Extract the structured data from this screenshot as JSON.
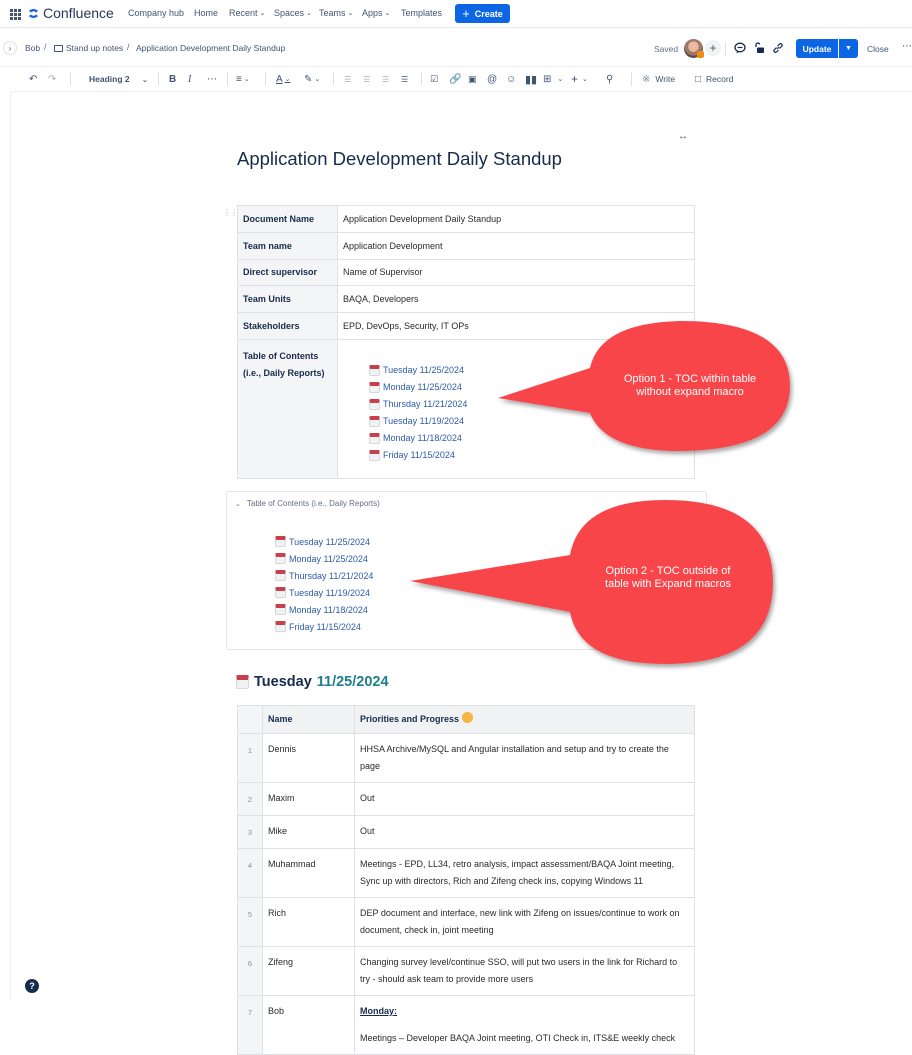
{
  "topnav": {
    "product": "Confluence",
    "items": [
      {
        "label": "Company hub",
        "dropdown": false
      },
      {
        "label": "Home",
        "dropdown": false
      },
      {
        "label": "Recent",
        "dropdown": true
      },
      {
        "label": "Spaces",
        "dropdown": true
      },
      {
        "label": "Teams",
        "dropdown": true
      },
      {
        "label": "Apps",
        "dropdown": true
      },
      {
        "label": "Templates",
        "dropdown": false
      }
    ],
    "create_label": "Create",
    "brand_color": "#0c66e4"
  },
  "subbar": {
    "breadcrumb": [
      "Bob",
      "Stand up notes",
      "Application Development Daily Standup"
    ],
    "saved_label": "Saved",
    "update_label": "Update",
    "close_label": "Close"
  },
  "toolbar": {
    "text_style": "Heading 2",
    "write_label": "Write",
    "record_label": "Record"
  },
  "page": {
    "title": "Application Development Daily Standup",
    "meta": [
      {
        "key": "Document Name",
        "value": "Application Development Daily Standup"
      },
      {
        "key": "Team name",
        "value": "Application Development"
      },
      {
        "key": "Direct supervisor",
        "value": "Name of Supervisor"
      },
      {
        "key": "Team Units",
        "value": "BAQA, Developers"
      },
      {
        "key": "Stakeholders",
        "value": "EPD, DevOps, Security, IT OPs"
      }
    ],
    "toc_key_line1": "Table of Contents",
    "toc_key_line2": "(i.e., Daily Reports)",
    "toc": [
      "Tuesday 11/25/2024",
      "Monday 11/25/2024",
      "Thursday 11/21/2024",
      "Tuesday 11/19/2024",
      "Monday 11/18/2024",
      "Friday 11/15/2024"
    ],
    "expand_title": "Table of Contents (i.e., Daily Reports)",
    "callouts": [
      {
        "line1": "Option 1 - TOC within table",
        "line2": "without expand macro",
        "color": "#f8444a"
      },
      {
        "line1": "Option 2 - TOC outside of",
        "line2": "table with Expand macros",
        "color": "#f8444a"
      }
    ],
    "section": {
      "day": "Tuesday",
      "date": "11/25/2024"
    },
    "standup": {
      "headers": [
        "Name",
        "Priorities and Progress"
      ],
      "rows": [
        {
          "num": "1",
          "name": "Dennis",
          "text": "HHSA Archive/MySQL and Angular installation and setup and try to create the page"
        },
        {
          "num": "2",
          "name": "Maxim",
          "text": "Out"
        },
        {
          "num": "3",
          "name": "Mike",
          "text": "Out"
        },
        {
          "num": "4",
          "name": "Muhammad",
          "text": "Meetings - EPD, LL34, retro analysis, impact assessment/BAQA Joint meeting, Sync up with directors, Rich and Zifeng check ins, copying Windows 11"
        },
        {
          "num": "5",
          "name": "Rich",
          "text": "DEP document and interface, new link with Zifeng on issues/continue to work on document, check in, joint meeting"
        },
        {
          "num": "6",
          "name": "Zifeng",
          "text": "Changing survey level/continue SSO, will put two users in the link for Richard to try - should ask team to provide more users"
        },
        {
          "num": "7",
          "name": "Bob",
          "heading": "Monday:",
          "text": "Meetings – Developer BAQA Joint meeting, OTI Check in, ITS&E weekly check"
        }
      ]
    }
  }
}
